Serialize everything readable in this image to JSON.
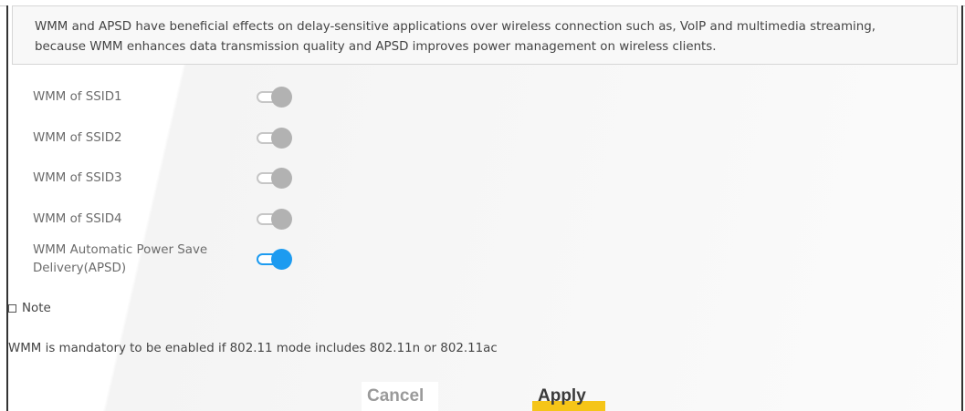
{
  "description": {
    "line1": "WMM and APSD have beneficial effects on delay-sensitive applications over wireless connection such as, VoIP and multimedia streaming,",
    "line2": "because WMM enhances data transmission quality and APSD improves power management on wireless clients."
  },
  "settings": [
    {
      "label": "WMM of SSID1",
      "enabled": false
    },
    {
      "label": "WMM of SSID2",
      "enabled": false
    },
    {
      "label": "WMM of SSID3",
      "enabled": false
    },
    {
      "label": "WMM of SSID4",
      "enabled": false
    },
    {
      "label": "WMM Automatic Power Save Delivery(APSD)",
      "enabled": true
    }
  ],
  "note": {
    "heading": "Note",
    "text": "WMM is mandatory to be enabled if 802.11 mode includes 802.11n or 802.11ac"
  },
  "buttons": {
    "cancel": "Cancel",
    "apply": "Apply"
  },
  "colors": {
    "toggle_on": "#1d9bf0",
    "toggle_off": "#b2b2b2",
    "apply_accent": "#f5c518"
  }
}
